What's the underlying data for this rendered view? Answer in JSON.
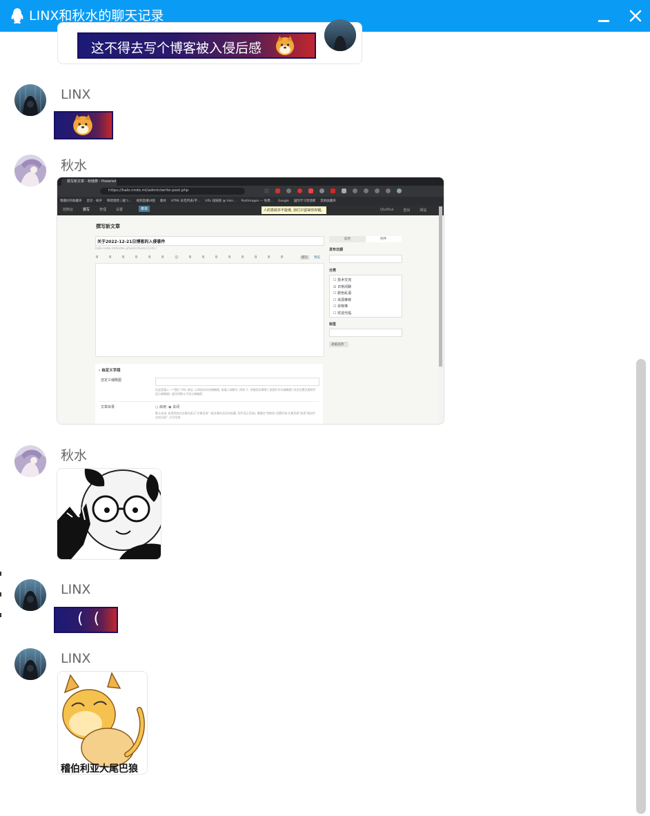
{
  "window": {
    "title": "LINX和秋水的聊天记录"
  },
  "messages": [
    {
      "banner_text": "这不得去写个博客被入侵后感"
    },
    {
      "sender": "LINX"
    },
    {
      "sender": "秋水",
      "screenshot": {
        "tab_title": "撰写新文章 - 秋储券 - Powered",
        "url": "https://halo.nndo.ml/admin/write-post.php",
        "bookmarks": [
          "我最好的收藏夹",
          "首页 - 知乎",
          "和哈哈哈 | 龍つ...",
          "视频直播UI图",
          "素材",
          "HTML 标签列表(字...",
          "URL 短链接 @ Inkn...",
          "Postimages — 免费...",
          "Google",
          "国际学习资源库",
          "其他收藏夹"
        ],
        "nav": [
          "控制台",
          "撰写",
          "管理",
          "设置"
        ],
        "nav_badge": "菜单",
        "notice": "人的意欲并不能缴, 别们只留得你你钢。",
        "nav_right": [
          "QiuShui",
          "登出",
          "网站"
        ],
        "page_title": "撰写新文章",
        "post_title": "关于2022-12-21日博客的入侵事件",
        "permalink": "halo.nndo.ml/index.php/archives/{cid}/",
        "tabs": [
          "选项",
          "附件"
        ],
        "publish_date_label": "发布日期",
        "category_label": "分类",
        "categories": [
          {
            "label": "技术交流",
            "checked": false
          },
          {
            "label": "日常闲聊",
            "checked": true
          },
          {
            "label": "颜色乱语",
            "checked": false
          },
          {
            "label": "资源推荐",
            "checked": false
          },
          {
            "label": "杂物堆",
            "checked": false
          },
          {
            "label": "欢迎光临",
            "checked": false
          }
        ],
        "tags_label": "标签",
        "advanced_button": "高级选项 ˇ",
        "custom_fields_label": "› 自定义字段",
        "thumb_label": "自定义缩略图",
        "thumb_help": "在这里填入一个图片 URL 地址, 以添加本文的缩略图, 若填入纯数字, 例如 3 , 则使用文章第三张图片作为缩略图 (对应位置无图则不显示缩略图), 留空则默认不显示缩略图",
        "toc_label": "文章目录",
        "toc_on": "启用",
        "toc_off": "关闭",
        "toc_help": "默认关闭, 启用则会在文章内显示\"文章目录\" (若文章内无任何标题, 则不显示目录), 需要在\"控制台-设置外观-文章页面\"启用\"侧边栏总览目录\", 方可生效",
        "toolbar_right": [
          "撰写",
          "预览"
        ]
      }
    },
    {
      "sender": "秋水"
    },
    {
      "sender": "LINX",
      "strip_text": "( ("
    },
    {
      "sender": "LINX",
      "sticker_caption": "稽伯利亚大尾巴狼"
    }
  ],
  "icons": [
    "qq-penguin-icon",
    "minimize-icon",
    "close-icon",
    "shiba-emoji-icon"
  ],
  "colors": {
    "titlebar": "#0a9cf5",
    "scrollbar": "#cfcfcf"
  }
}
